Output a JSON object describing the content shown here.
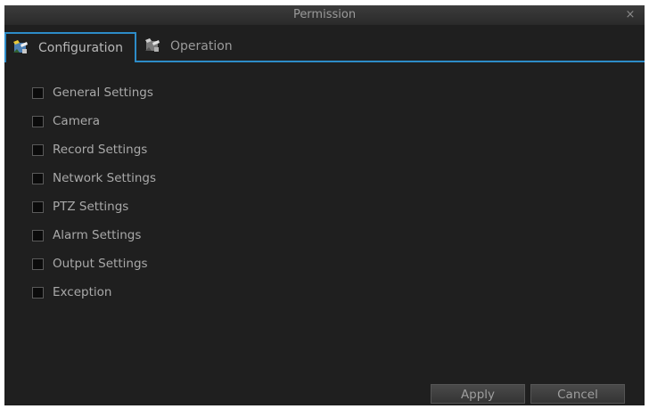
{
  "window": {
    "title": "Permission",
    "close_glyph": "×"
  },
  "tabs": [
    {
      "label": "Configuration",
      "icon": "configuration-icon",
      "active": true
    },
    {
      "label": "Operation",
      "icon": "operation-icon",
      "active": false
    }
  ],
  "permissions": [
    {
      "label": "General Settings",
      "checked": false
    },
    {
      "label": "Camera",
      "checked": false
    },
    {
      "label": "Record Settings",
      "checked": false
    },
    {
      "label": "Network Settings",
      "checked": false
    },
    {
      "label": "PTZ Settings",
      "checked": false
    },
    {
      "label": "Alarm Settings",
      "checked": false
    },
    {
      "label": "Output Settings",
      "checked": false
    },
    {
      "label": "Exception",
      "checked": false
    }
  ],
  "buttons": {
    "apply_label": "Apply",
    "cancel_label": "Cancel"
  },
  "colors": {
    "accent": "#2d8cc8",
    "background": "#1f1f1f",
    "text": "#a9a9a9"
  }
}
